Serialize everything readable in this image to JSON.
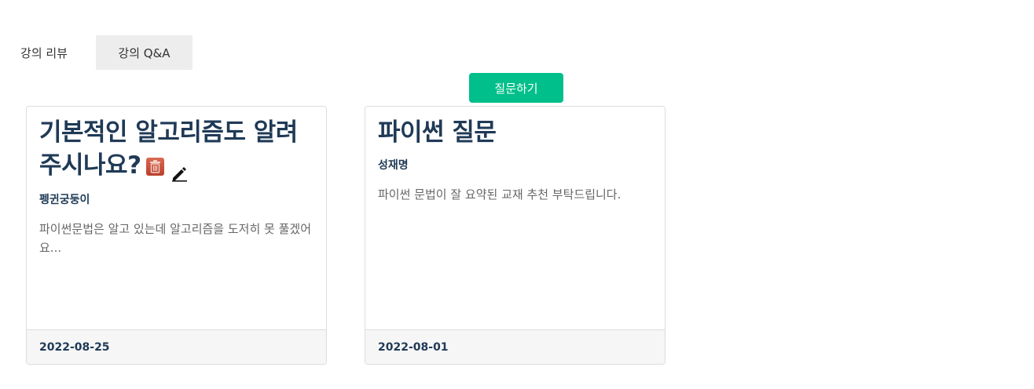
{
  "tabs": {
    "review_label": "강의 리뷰",
    "qna_label": "강의 Q&A"
  },
  "ask_button_label": "질문하기",
  "questions": [
    {
      "title": "기본적인 알고리즘도 알려주시나요?",
      "author": "펭귄궁둥이",
      "content": "파이썬문법은 알고 있는데 알고리즘을 도저히 못 풀겠어요...",
      "date": "2022-08-25",
      "icons": [
        "trash-icon",
        "pencil-icon"
      ]
    },
    {
      "title": "파이썬 질문",
      "author": "성재명",
      "content": "파이썬 문법이 잘 요약된 교재 추천 부탁드립니다.",
      "date": "2022-08-01"
    }
  ],
  "colors": {
    "accent": "#00bf8a",
    "title": "#1f3a56",
    "tab_active_bg": "#ededed",
    "trash_icon": "#c9553f"
  }
}
